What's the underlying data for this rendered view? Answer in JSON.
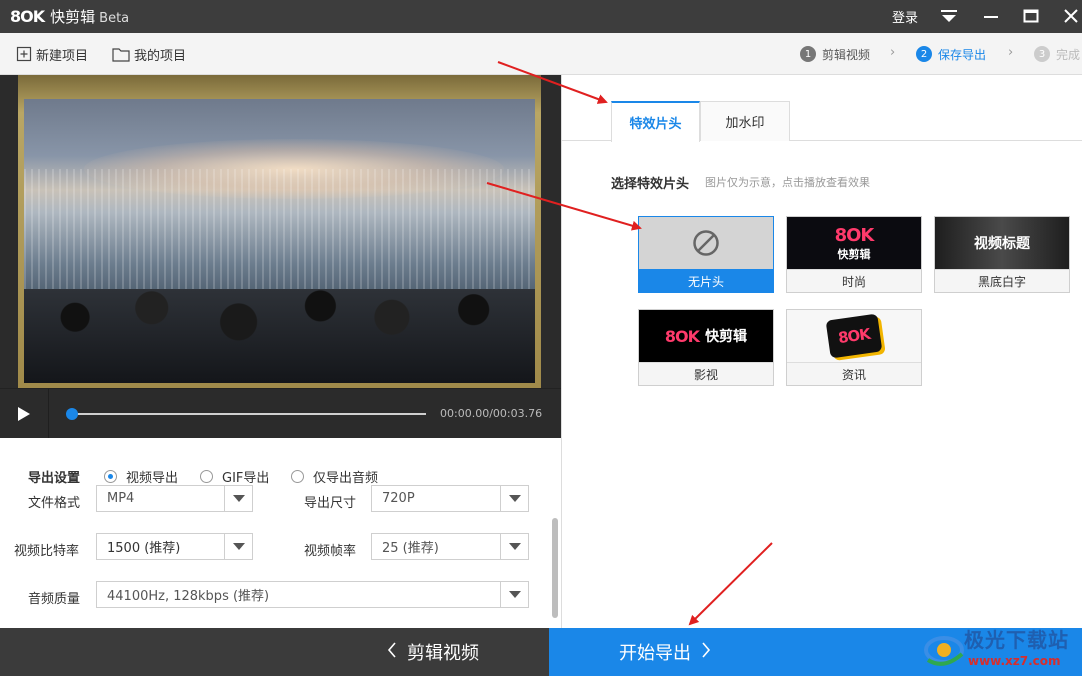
{
  "titlebar": {
    "logo": "8OK",
    "app_name": "快剪辑",
    "beta": "Beta",
    "login_label": "登录",
    "icons": [
      "dropdown-menu-icon",
      "minimize-icon",
      "maximize-icon",
      "close-icon"
    ]
  },
  "toolbar": {
    "new_project": "新建项目",
    "my_projects": "我的项目",
    "steps": [
      {
        "num": "1",
        "label": "剪辑视频",
        "state": "done"
      },
      {
        "num": "2",
        "label": "保存导出",
        "state": "active"
      },
      {
        "num": "3",
        "label": "完成",
        "state": "future"
      }
    ]
  },
  "player": {
    "timecode": "00:00.00/00:03.76",
    "progress_fraction": 0.0
  },
  "export_settings": {
    "title": "导出设置",
    "radio_options": [
      {
        "label": "视频导出",
        "selected": true
      },
      {
        "label": "GIF导出",
        "selected": false
      },
      {
        "label": "仅导出音频",
        "selected": false
      }
    ],
    "file_format_label": "文件格式",
    "file_format_value": "MP4",
    "export_size_label": "导出尺寸",
    "export_size_value": "720P",
    "bitrate_label": "视频比特率",
    "bitrate_value": "1500 (推荐)",
    "framerate_label": "视频帧率",
    "framerate_value": "25 (推荐)",
    "audio_quality_label": "音频质量",
    "audio_quality_value": "44100Hz, 128kbps (推荐)"
  },
  "right_panel": {
    "tabs": [
      {
        "label": "特效片头",
        "active": true
      },
      {
        "label": "加水印",
        "active": false
      }
    ],
    "intro_title": "选择特效片头",
    "intro_hint": "图片仅为示意，点击播放查看效果",
    "intros": [
      {
        "caption": "无片头",
        "selected": true,
        "thumb": "none"
      },
      {
        "caption": "时尚",
        "selected": false,
        "thumb": "fashion",
        "thumb_logo": "8OK",
        "thumb_text": "快剪辑"
      },
      {
        "caption": "黑底白字",
        "selected": false,
        "thumb": "text",
        "thumb_text": "视频标题"
      },
      {
        "caption": "影视",
        "selected": false,
        "thumb": "film",
        "thumb_logo": "8OK",
        "thumb_text": "快剪辑"
      },
      {
        "caption": "资讯",
        "selected": false,
        "thumb": "news",
        "thumb_logo": "8OK"
      }
    ]
  },
  "bottom": {
    "back_label": "剪辑视频",
    "start_label": "开始导出"
  },
  "watermark": {
    "title": "极光下载站",
    "url": "www.xz7.com"
  },
  "colors": {
    "accent": "#1a87e8",
    "titlebar": "#3d3d3d",
    "annotation_arrow": "#e02020"
  }
}
